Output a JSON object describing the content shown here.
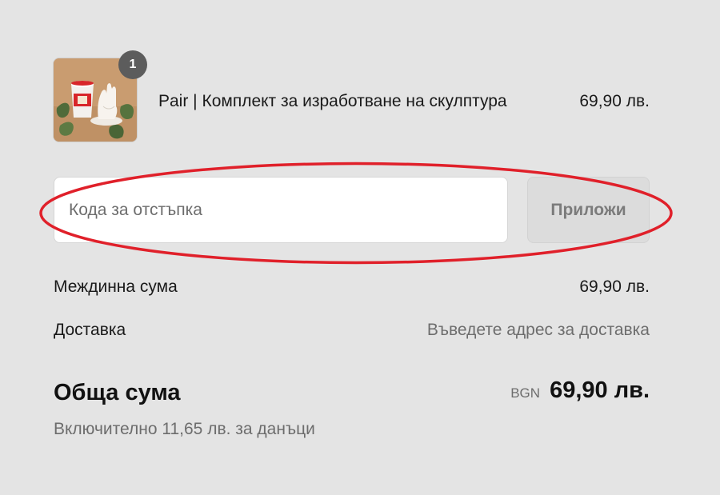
{
  "product": {
    "quantity": "1",
    "name": "Pair | Комплект за изработване на скулптура",
    "price": "69,90 лв.",
    "thumbnail_icon": "product-photo-icon"
  },
  "discount": {
    "placeholder": "Кода за отстъпка",
    "value": "",
    "apply_label": "Приложи"
  },
  "totals": {
    "subtotal_label": "Междинна сума",
    "subtotal_value": "69,90 лв.",
    "shipping_label": "Доставка",
    "shipping_value": "Въведете адрес за доставка",
    "total_label": "Обща сума",
    "currency_code": "BGN",
    "total_value": "69,90 лв.",
    "tax_note": "Включително 11,65 лв. за данъци"
  },
  "colors": {
    "background": "#e4e4e4",
    "highlight": "#e0202a",
    "badge": "#5c5c5c",
    "muted_text": "#6d6d6d"
  }
}
